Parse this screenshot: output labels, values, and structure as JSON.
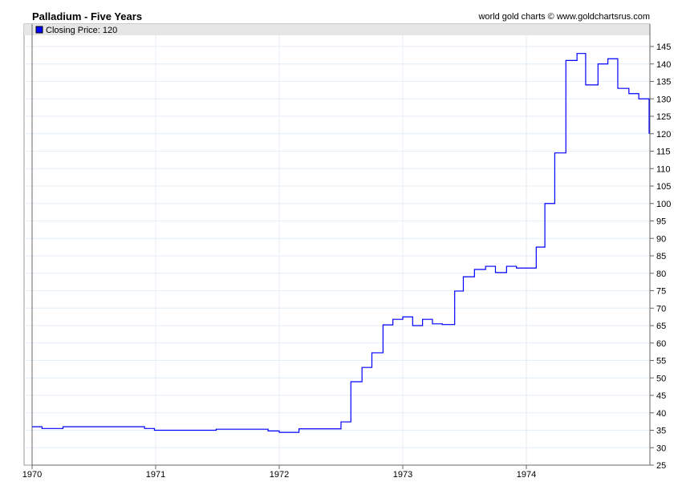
{
  "chart_data": {
    "type": "line",
    "step": true,
    "title": "Palladium - Five Years",
    "credit": "world gold charts © www.goldchartsrus.com",
    "legend": {
      "label": "Closing Price: 120",
      "color": "#0000ff",
      "placement": "top-left"
    },
    "xlabel": "",
    "ylabel": "",
    "xlim": [
      1970,
      1975
    ],
    "ylim": [
      25,
      147.5
    ],
    "x_ticks": [
      "1970",
      "1971",
      "1972",
      "1973",
      "1974"
    ],
    "y_ticks": [
      25,
      30,
      35,
      40,
      45,
      50,
      55,
      60,
      65,
      70,
      75,
      80,
      85,
      90,
      95,
      100,
      105,
      110,
      115,
      120,
      125,
      130,
      135,
      140,
      145
    ],
    "grid": true,
    "series": [
      {
        "name": "Closing Price",
        "color": "#0000ff",
        "points": [
          [
            1970.0,
            36
          ],
          [
            1970.08,
            35.5
          ],
          [
            1970.25,
            36
          ],
          [
            1970.91,
            35.5
          ],
          [
            1970.99,
            35
          ],
          [
            1971.49,
            35.3
          ],
          [
            1971.91,
            34.8
          ],
          [
            1972.0,
            34.4
          ],
          [
            1972.16,
            35.4
          ],
          [
            1972.5,
            37.4
          ],
          [
            1972.58,
            48.9
          ],
          [
            1972.67,
            53
          ],
          [
            1972.75,
            57.2
          ],
          [
            1972.84,
            65.2
          ],
          [
            1972.92,
            66.8
          ],
          [
            1973.0,
            67.5
          ],
          [
            1973.08,
            65
          ],
          [
            1973.16,
            66.8
          ],
          [
            1973.24,
            65.5
          ],
          [
            1973.32,
            65.3
          ],
          [
            1973.42,
            74.9
          ],
          [
            1973.49,
            79
          ],
          [
            1973.58,
            81.1
          ],
          [
            1973.67,
            82
          ],
          [
            1973.75,
            80.2
          ],
          [
            1973.84,
            82
          ],
          [
            1973.92,
            81.5
          ],
          [
            1974.08,
            87.5
          ],
          [
            1974.15,
            100
          ],
          [
            1974.23,
            114.5
          ],
          [
            1974.32,
            141
          ],
          [
            1974.41,
            143
          ],
          [
            1974.48,
            134
          ],
          [
            1974.58,
            140
          ],
          [
            1974.66,
            141.5
          ],
          [
            1974.74,
            133
          ],
          [
            1974.83,
            131.5
          ],
          [
            1974.91,
            130
          ],
          [
            1974.99,
            120
          ]
        ]
      }
    ]
  }
}
